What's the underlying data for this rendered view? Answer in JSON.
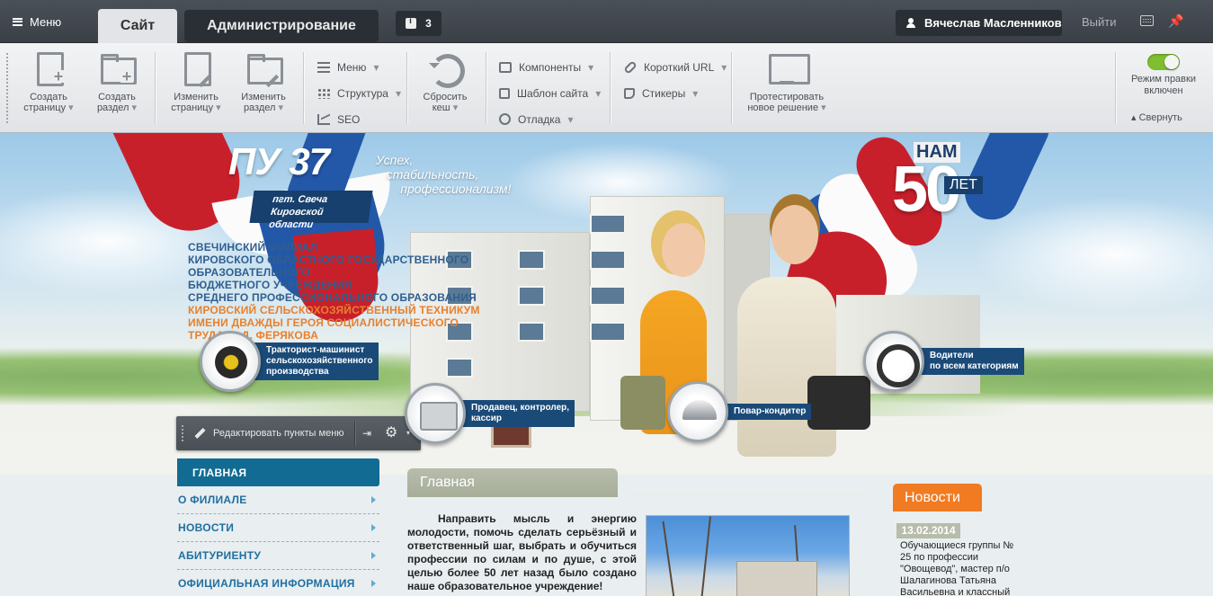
{
  "topbar": {
    "menu_label": "Меню",
    "tab_site": "Сайт",
    "tab_admin": "Администрирование",
    "notifications_count": "3",
    "user_name": "Вячеслав Масленников",
    "logout": "Выйти",
    "icons": [
      "menu-icon",
      "info-icon",
      "user-icon",
      "keyboard-icon",
      "pin-icon"
    ]
  },
  "toolbar": {
    "create_page": [
      "Создать",
      "страницу"
    ],
    "create_section": [
      "Создать",
      "раздел"
    ],
    "edit_page": [
      "Изменить",
      "страницу"
    ],
    "edit_section": [
      "Изменить",
      "раздел"
    ],
    "menu": "Меню",
    "structure": "Структура",
    "seo": "SEO",
    "reset_cache": [
      "Сбросить",
      "кеш"
    ],
    "components": "Компоненты",
    "site_template": "Шаблон сайта",
    "debug": "Отладка",
    "short_url": "Короткий URL",
    "stickers": "Стикеры",
    "test_solution": [
      "Протестировать",
      "новое решение"
    ],
    "edit_mode": [
      "Режим правки",
      "включен"
    ],
    "collapse": "Свернуть"
  },
  "header": {
    "logo_main": "ПУ 37",
    "logo_sub": [
      "пгт. Свеча",
      "Кировской области"
    ],
    "slogan": [
      "Успех,",
      "стабильность,",
      "профессионализм!"
    ],
    "anniversary": {
      "nam": "НАМ",
      "number": "50",
      "let": "ЛЕТ"
    },
    "institution_lines_blue": [
      "СВЕЧИНСКИЙ ФИЛИАЛ",
      "КИРОВСКОГО ОБЛАСТНОГО ГОСУДАРСТВЕННОГО",
      "ОБРАЗОВАТЕЛЬНОГО",
      "БЮДЖЕТНОГО УЧРЕЖДЕНИЯ",
      "СРЕДНЕГО ПРОФЕССИОНАЛЬНОГО ОБРАЗОВАНИЯ"
    ],
    "institution_lines_orange": [
      "КИРОВСКИЙ СЕЛЬСКОХОЗЯЙСТВЕННЫЙ ТЕХНИКУМ",
      "ИМЕНИ ДВАЖДЫ ГЕРОЯ СОЦИАЛИСТИЧЕСКОГО",
      "ТРУДА А. Д. ФЕРЯКОВА"
    ],
    "specialties": [
      {
        "icon": "tire-icon",
        "lines": [
          "Тракторист-машинист",
          "сельскохозяйственного",
          "производства"
        ]
      },
      {
        "icon": "calculator-icon",
        "lines": [
          "Продавец, контролер,",
          "кассир"
        ]
      },
      {
        "icon": "cloche-icon",
        "lines": [
          "Повар-кондитер"
        ]
      },
      {
        "icon": "steering-wheel-icon",
        "lines": [
          "Водители",
          "по всем категориям"
        ]
      }
    ]
  },
  "menubar": {
    "edit_label": "Редактировать пункты меню"
  },
  "leftnav": {
    "items": [
      {
        "label": "ГЛАВНАЯ",
        "active": true
      },
      {
        "label": "О ФИЛИАЛЕ"
      },
      {
        "label": "НОВОСТИ"
      },
      {
        "label": "АБИТУРИЕНТУ"
      },
      {
        "label": "ОФИЦИАЛЬНАЯ ИНФОРМАЦИЯ"
      }
    ]
  },
  "content": {
    "title": "Главная",
    "text": "Направить мысль и энергию молодости, помочь сделать серьёзный и ответственный шаг, выбрать и обучиться профессии по силам и по душе, с этой целью более 50 лет назад было создано наше образовательное учреждение!"
  },
  "news": {
    "title": "Новости",
    "date": "13.02.2014",
    "text": "Обучающиеся группы № 25 по профессии \"Овощевод\", мастер п/о Шалагинова Татьяна Васильевна и классный"
  },
  "colors": {
    "admin_bar": "#3b4047",
    "toolbar": "#e1e3e6",
    "nav_active": "#126b92",
    "nav_link": "#1f6fa0",
    "news_accent": "#f07b22",
    "content_title": "#a6ad98",
    "toggle_on": "#7fbf2f"
  }
}
